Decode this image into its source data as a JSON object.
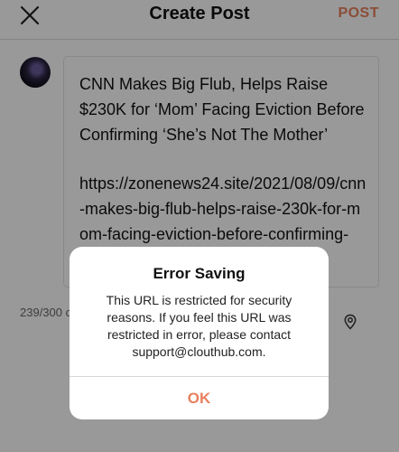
{
  "header": {
    "title": "Create Post",
    "post_label": "POST",
    "close_icon": "close-icon"
  },
  "post": {
    "text": "CNN Makes Big Flub, Helps Raise $230K for ‘Mom’ Facing Eviction Before Confirming ‘She’s Not The Mother’",
    "url": "https://zonenews24.site/2021/08/09/cnn-makes-big-flub-helps-raise-230k-for-mom-facing-eviction-before-confirming-"
  },
  "footer": {
    "char_count": "239/300 c",
    "location_icon": "location-pin-icon"
  },
  "dialog": {
    "title": "Error Saving",
    "message": "This URL is restricted for security reasons. If you feel this URL was restricted in error, please contact support@clouthub.com.",
    "ok_label": "OK"
  },
  "colors": {
    "accent": "#e8805e",
    "overlay": "rgba(0,0,0,0.40)"
  }
}
